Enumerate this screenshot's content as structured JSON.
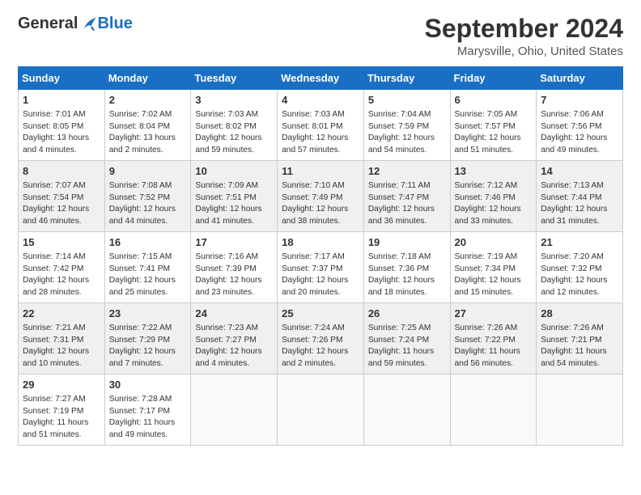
{
  "logo": {
    "general": "General",
    "blue": "Blue"
  },
  "title": "September 2024",
  "location": "Marysville, Ohio, United States",
  "days_of_week": [
    "Sunday",
    "Monday",
    "Tuesday",
    "Wednesday",
    "Thursday",
    "Friday",
    "Saturday"
  ],
  "weeks": [
    [
      {
        "num": "1",
        "sunrise": "7:01 AM",
        "sunset": "8:05 PM",
        "daylight": "13 hours and 4 minutes."
      },
      {
        "num": "2",
        "sunrise": "7:02 AM",
        "sunset": "8:04 PM",
        "daylight": "13 hours and 2 minutes."
      },
      {
        "num": "3",
        "sunrise": "7:03 AM",
        "sunset": "8:02 PM",
        "daylight": "12 hours and 59 minutes."
      },
      {
        "num": "4",
        "sunrise": "7:03 AM",
        "sunset": "8:01 PM",
        "daylight": "12 hours and 57 minutes."
      },
      {
        "num": "5",
        "sunrise": "7:04 AM",
        "sunset": "7:59 PM",
        "daylight": "12 hours and 54 minutes."
      },
      {
        "num": "6",
        "sunrise": "7:05 AM",
        "sunset": "7:57 PM",
        "daylight": "12 hours and 51 minutes."
      },
      {
        "num": "7",
        "sunrise": "7:06 AM",
        "sunset": "7:56 PM",
        "daylight": "12 hours and 49 minutes."
      }
    ],
    [
      {
        "num": "8",
        "sunrise": "7:07 AM",
        "sunset": "7:54 PM",
        "daylight": "12 hours and 46 minutes."
      },
      {
        "num": "9",
        "sunrise": "7:08 AM",
        "sunset": "7:52 PM",
        "daylight": "12 hours and 44 minutes."
      },
      {
        "num": "10",
        "sunrise": "7:09 AM",
        "sunset": "7:51 PM",
        "daylight": "12 hours and 41 minutes."
      },
      {
        "num": "11",
        "sunrise": "7:10 AM",
        "sunset": "7:49 PM",
        "daylight": "12 hours and 38 minutes."
      },
      {
        "num": "12",
        "sunrise": "7:11 AM",
        "sunset": "7:47 PM",
        "daylight": "12 hours and 36 minutes."
      },
      {
        "num": "13",
        "sunrise": "7:12 AM",
        "sunset": "7:46 PM",
        "daylight": "12 hours and 33 minutes."
      },
      {
        "num": "14",
        "sunrise": "7:13 AM",
        "sunset": "7:44 PM",
        "daylight": "12 hours and 31 minutes."
      }
    ],
    [
      {
        "num": "15",
        "sunrise": "7:14 AM",
        "sunset": "7:42 PM",
        "daylight": "12 hours and 28 minutes."
      },
      {
        "num": "16",
        "sunrise": "7:15 AM",
        "sunset": "7:41 PM",
        "daylight": "12 hours and 25 minutes."
      },
      {
        "num": "17",
        "sunrise": "7:16 AM",
        "sunset": "7:39 PM",
        "daylight": "12 hours and 23 minutes."
      },
      {
        "num": "18",
        "sunrise": "7:17 AM",
        "sunset": "7:37 PM",
        "daylight": "12 hours and 20 minutes."
      },
      {
        "num": "19",
        "sunrise": "7:18 AM",
        "sunset": "7:36 PM",
        "daylight": "12 hours and 18 minutes."
      },
      {
        "num": "20",
        "sunrise": "7:19 AM",
        "sunset": "7:34 PM",
        "daylight": "12 hours and 15 minutes."
      },
      {
        "num": "21",
        "sunrise": "7:20 AM",
        "sunset": "7:32 PM",
        "daylight": "12 hours and 12 minutes."
      }
    ],
    [
      {
        "num": "22",
        "sunrise": "7:21 AM",
        "sunset": "7:31 PM",
        "daylight": "12 hours and 10 minutes."
      },
      {
        "num": "23",
        "sunrise": "7:22 AM",
        "sunset": "7:29 PM",
        "daylight": "12 hours and 7 minutes."
      },
      {
        "num": "24",
        "sunrise": "7:23 AM",
        "sunset": "7:27 PM",
        "daylight": "12 hours and 4 minutes."
      },
      {
        "num": "25",
        "sunrise": "7:24 AM",
        "sunset": "7:26 PM",
        "daylight": "12 hours and 2 minutes."
      },
      {
        "num": "26",
        "sunrise": "7:25 AM",
        "sunset": "7:24 PM",
        "daylight": "11 hours and 59 minutes."
      },
      {
        "num": "27",
        "sunrise": "7:26 AM",
        "sunset": "7:22 PM",
        "daylight": "11 hours and 56 minutes."
      },
      {
        "num": "28",
        "sunrise": "7:26 AM",
        "sunset": "7:21 PM",
        "daylight": "11 hours and 54 minutes."
      }
    ],
    [
      {
        "num": "29",
        "sunrise": "7:27 AM",
        "sunset": "7:19 PM",
        "daylight": "11 hours and 51 minutes."
      },
      {
        "num": "30",
        "sunrise": "7:28 AM",
        "sunset": "7:17 PM",
        "daylight": "11 hours and 49 minutes."
      },
      null,
      null,
      null,
      null,
      null
    ]
  ]
}
